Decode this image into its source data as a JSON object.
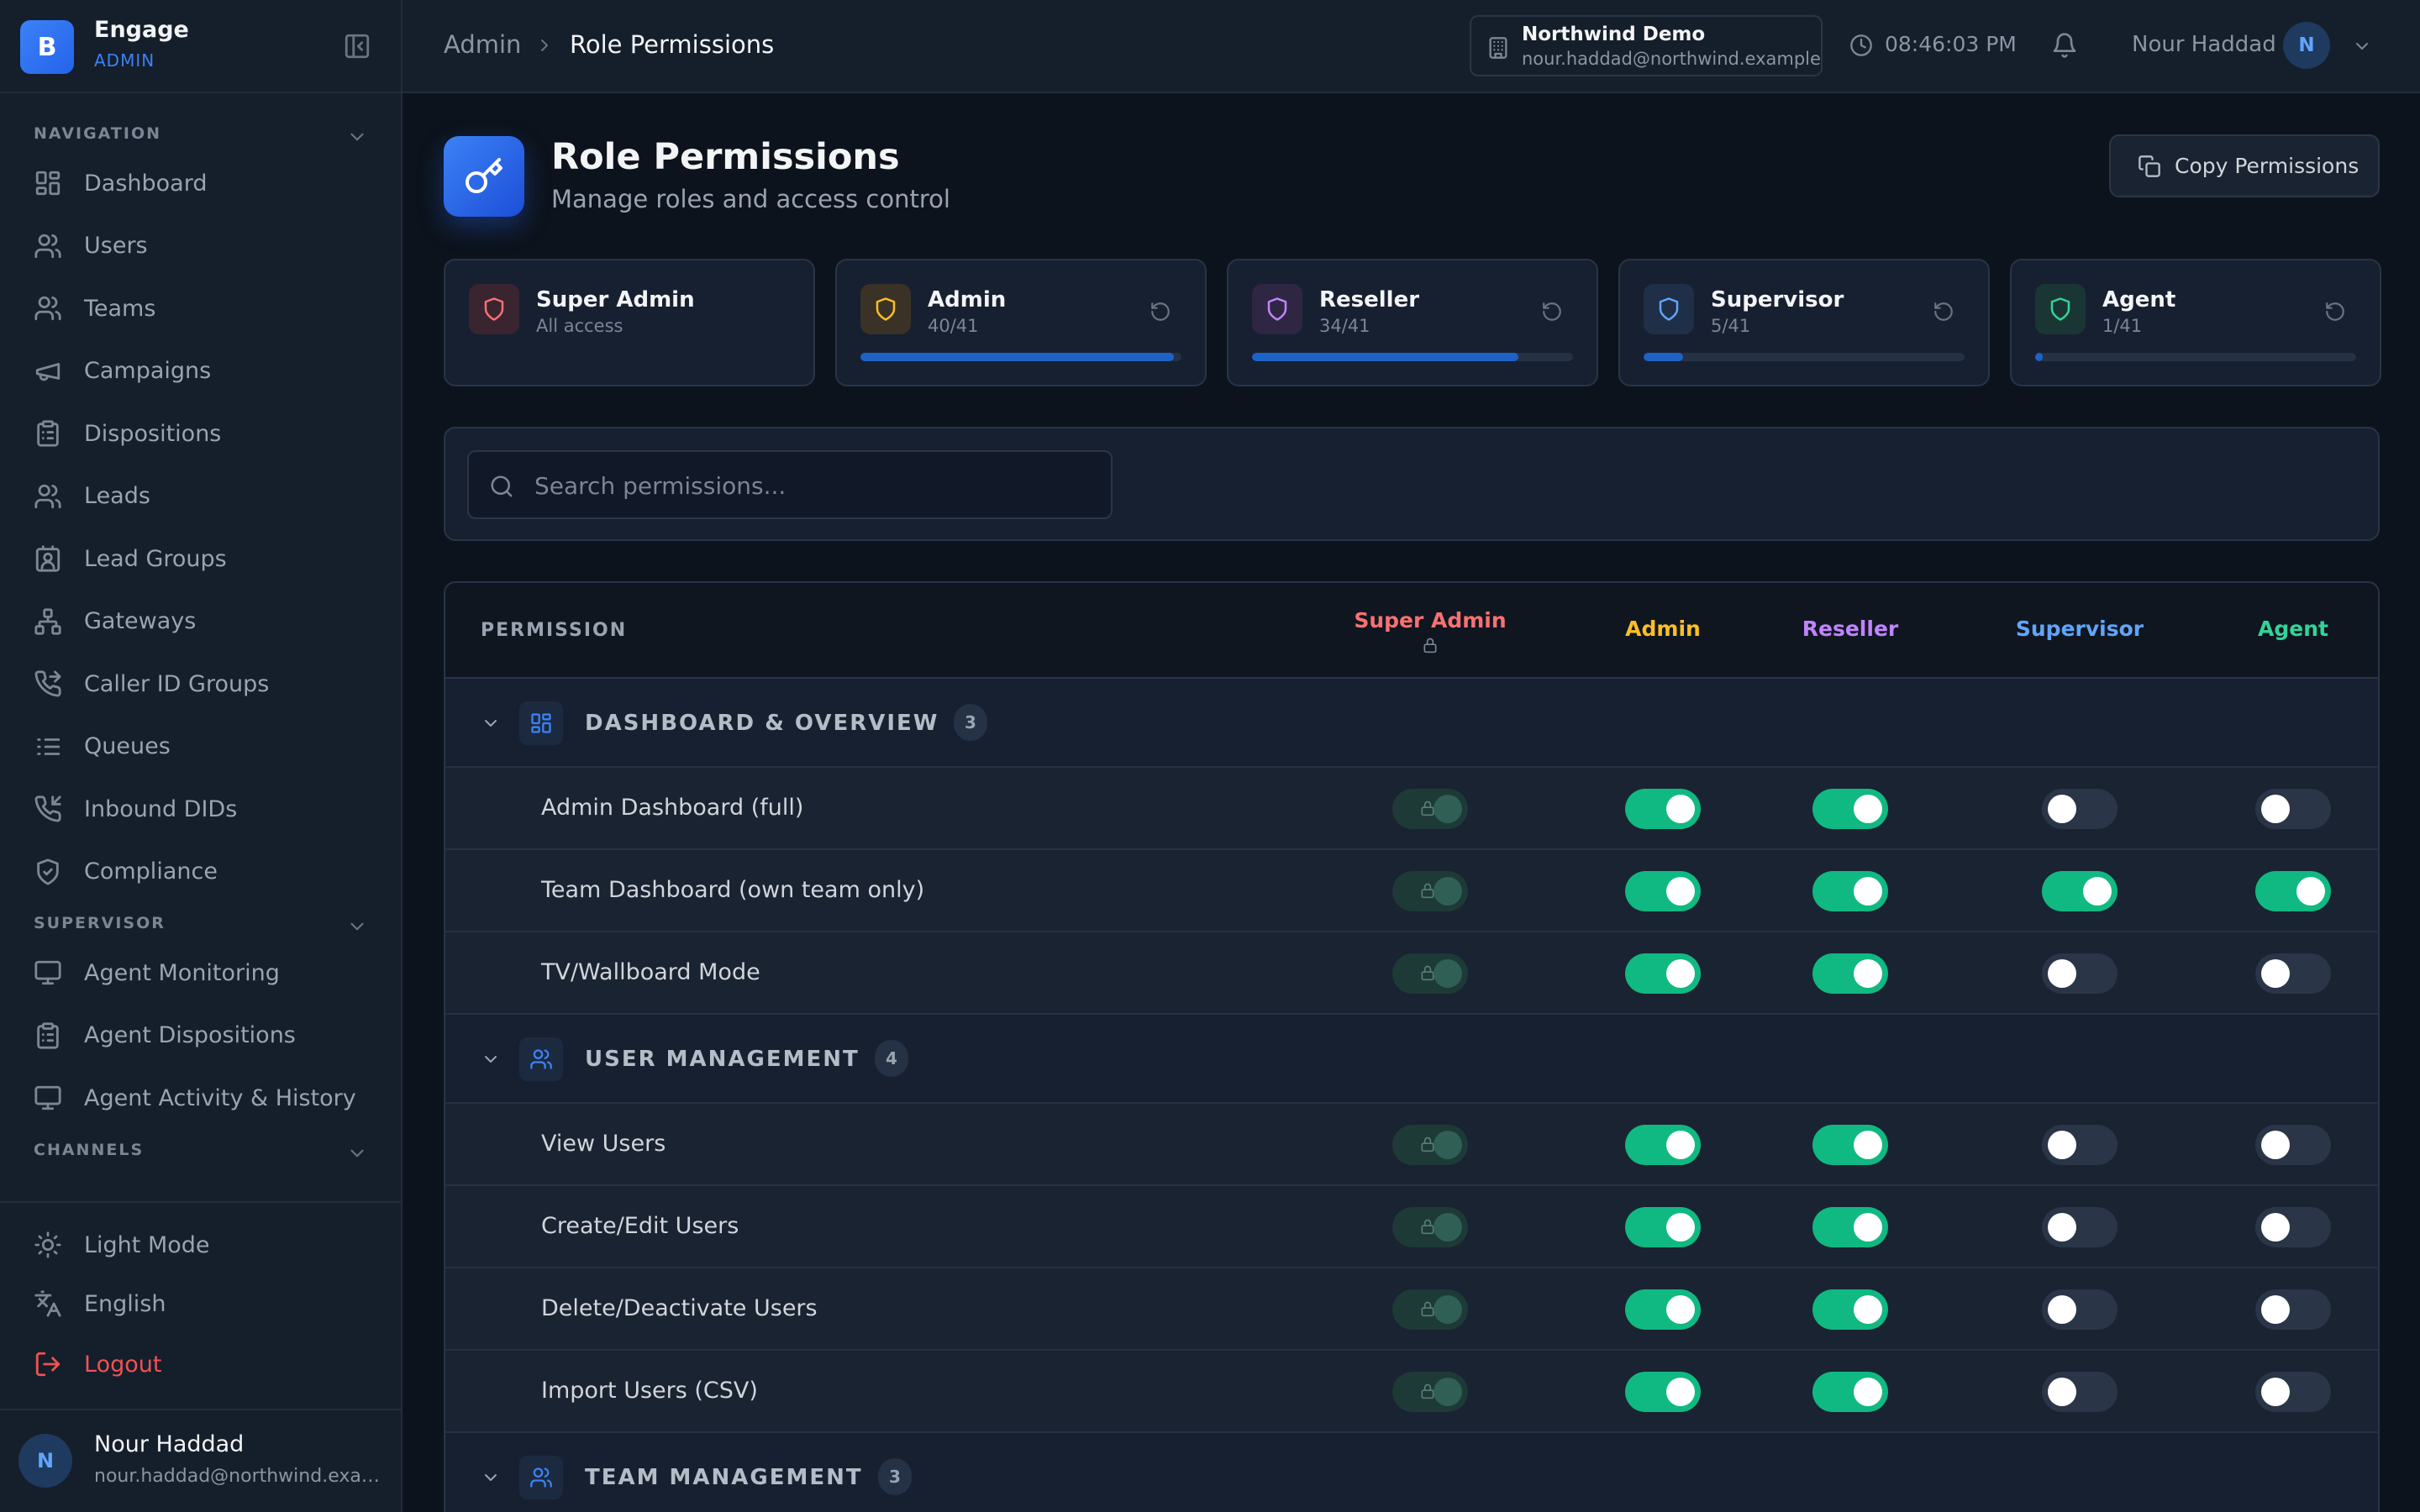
{
  "brand": {
    "letter": "B",
    "name": "Engage",
    "role": "ADMIN"
  },
  "sidebar": {
    "sections": [
      {
        "title": "NAVIGATION",
        "items": [
          {
            "label": "Dashboard",
            "icon": "grid-icon"
          },
          {
            "label": "Users",
            "icon": "users-icon"
          },
          {
            "label": "Teams",
            "icon": "users-icon"
          },
          {
            "label": "Campaigns",
            "icon": "megaphone-icon"
          },
          {
            "label": "Dispositions",
            "icon": "clipboard-icon"
          },
          {
            "label": "Leads",
            "icon": "users-icon"
          },
          {
            "label": "Lead Groups",
            "icon": "contact-icon"
          },
          {
            "label": "Gateways",
            "icon": "network-icon"
          },
          {
            "label": "Caller ID Groups",
            "icon": "phone-forward-icon"
          },
          {
            "label": "Queues",
            "icon": "list-icon"
          },
          {
            "label": "Inbound DIDs",
            "icon": "phone-incoming-icon"
          },
          {
            "label": "Compliance",
            "icon": "shield-check-icon"
          }
        ]
      },
      {
        "title": "SUPERVISOR",
        "items": [
          {
            "label": "Agent Monitoring",
            "icon": "monitor-icon"
          },
          {
            "label": "Agent Dispositions",
            "icon": "clipboard-icon"
          },
          {
            "label": "Agent Activity & History",
            "icon": "monitor-icon"
          }
        ]
      },
      {
        "title": "CHANNELS",
        "items": []
      }
    ],
    "bottom": {
      "theme_label": "Light Mode",
      "language_label": "English",
      "logout_label": "Logout"
    },
    "profile": {
      "initial": "N",
      "name": "Nour Haddad",
      "email": "nour.haddad@northwind.example"
    }
  },
  "topbar": {
    "breadcrumb": [
      "Admin",
      "Role Permissions"
    ],
    "org": {
      "name": "Northwind Demo",
      "email": "nour.haddad@northwind.example"
    },
    "clock": "08:46:03 PM",
    "user": {
      "name": "Nour Haddad",
      "initial": "N"
    }
  },
  "page": {
    "title": "Role Permissions",
    "subtitle": "Manage roles and access control",
    "copy_label": "Copy Permissions"
  },
  "roles": [
    {
      "name": "Super Admin",
      "count": "All access",
      "color": "#f87171",
      "bg": "#3a2430",
      "progress": null,
      "resettable": false
    },
    {
      "name": "Admin",
      "count": "40/41",
      "color": "#fbbf24",
      "bg": "#3a3226",
      "progress": 0.976,
      "resettable": true
    },
    {
      "name": "Reseller",
      "count": "34/41",
      "color": "#c084fc",
      "bg": "#2f2643",
      "progress": 0.829,
      "resettable": true
    },
    {
      "name": "Supervisor",
      "count": "5/41",
      "color": "#60a5fa",
      "bg": "#1f2f48",
      "progress": 0.122,
      "resettable": true
    },
    {
      "name": "Agent",
      "count": "1/41",
      "color": "#34d399",
      "bg": "#1a3634",
      "progress": 0.024,
      "resettable": true
    }
  ],
  "search": {
    "placeholder": "Search permissions..."
  },
  "table": {
    "permission_header": "PERMISSION",
    "groups": [
      {
        "label": "DASHBOARD & OVERVIEW",
        "count": "3",
        "icon": "grid-icon",
        "rows": [
          {
            "label": "Admin Dashboard (full)",
            "values": [
              true,
              true,
              false,
              false
            ]
          },
          {
            "label": "Team Dashboard (own team only)",
            "values": [
              true,
              true,
              true,
              true
            ]
          },
          {
            "label": "TV/Wallboard Mode",
            "values": [
              true,
              true,
              false,
              false
            ]
          }
        ]
      },
      {
        "label": "USER MANAGEMENT",
        "count": "4",
        "icon": "users-icon",
        "rows": [
          {
            "label": "View Users",
            "values": [
              true,
              true,
              false,
              false
            ]
          },
          {
            "label": "Create/Edit Users",
            "values": [
              true,
              true,
              false,
              false
            ]
          },
          {
            "label": "Delete/Deactivate Users",
            "values": [
              true,
              true,
              false,
              false
            ]
          },
          {
            "label": "Import Users (CSV)",
            "values": [
              true,
              true,
              false,
              false
            ]
          }
        ]
      },
      {
        "label": "TEAM MANAGEMENT",
        "count": "3",
        "icon": "users-icon",
        "rows": []
      }
    ]
  }
}
